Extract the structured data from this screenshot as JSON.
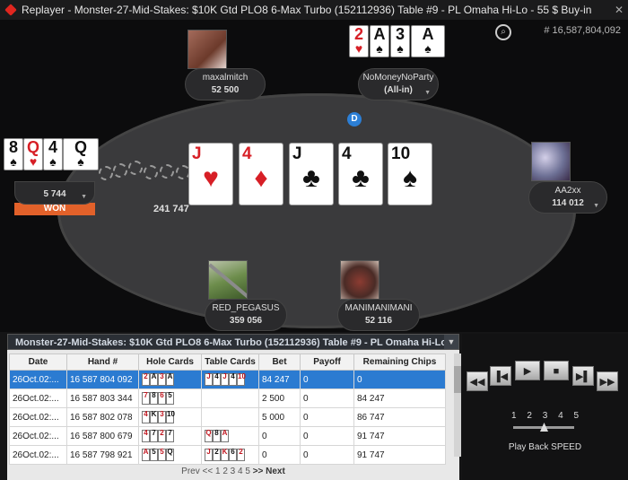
{
  "window": {
    "title": "Replayer - Monster-27-Mid-Stakes: $10K Gtd PLO8 6-Max Turbo (152112936) Table #9 -  PL  Omaha Hi-Lo - 55 $ Buy-in",
    "close": "✕"
  },
  "table": {
    "hand_number": "# 16,587,804,092",
    "pot": "241 747",
    "dealer": "D",
    "board": [
      {
        "r": "J",
        "s": "♥",
        "c": "red"
      },
      {
        "r": "4",
        "s": "♦",
        "c": "red"
      },
      {
        "r": "J",
        "s": "♣",
        "c": "blk"
      },
      {
        "r": "4",
        "s": "♣",
        "c": "blk"
      },
      {
        "r": "10",
        "s": "♠",
        "c": "blk"
      }
    ],
    "players": [
      {
        "name": "maxalmitch",
        "stack": "52 500"
      },
      {
        "name": "NoMoneyNoParty",
        "stack": "(All-in)",
        "cards": [
          {
            "r": "2",
            "s": "♥",
            "c": "red"
          },
          {
            "r": "A",
            "s": "♠",
            "c": "blk"
          },
          {
            "r": "3",
            "s": "♠",
            "c": "blk"
          },
          {
            "r": "A",
            "s": "♠",
            "c": "blk"
          }
        ]
      },
      {
        "name": "AA2xx",
        "stack": "114 012"
      },
      {
        "name": "MANIMANIMANI",
        "stack": "52 116"
      },
      {
        "name": "RED_PEGASUS",
        "stack": "359 056"
      },
      {
        "name": "",
        "stack": "5 744",
        "badge": "WON",
        "cards": [
          {
            "r": "8",
            "s": "♠",
            "c": "blk"
          },
          {
            "r": "Q",
            "s": "♥",
            "c": "red"
          },
          {
            "r": "4",
            "s": "♠",
            "c": "blk"
          },
          {
            "r": "Q",
            "s": "♠",
            "c": "blk"
          }
        ]
      }
    ]
  },
  "history": {
    "title": "Monster-27-Mid-Stakes: $10K Gtd PLO8 6-Max Turbo (152112936) Table #9 -  PL  Omaha Hi-Lo -",
    "columns": [
      "Date",
      "Hand #",
      "Hole Cards",
      "Table Cards",
      "Bet",
      "Payoff",
      "Remaining Chips"
    ],
    "rows": [
      {
        "date": "26Oct.02:...",
        "hand": "16 587 804 092",
        "hole": [
          "2",
          "A",
          "3",
          "A"
        ],
        "table": [
          "J",
          "4",
          "J",
          "4",
          "10"
        ],
        "bet": "84 247",
        "payoff": "0",
        "remaining": "0"
      },
      {
        "date": "26Oct.02:...",
        "hand": "16 587 803 344",
        "hole": [
          "7",
          "8",
          "6",
          "5"
        ],
        "table": [],
        "bet": "2 500",
        "payoff": "0",
        "remaining": "84 247"
      },
      {
        "date": "26Oct.02:...",
        "hand": "16 587 802 078",
        "hole": [
          "4",
          "K",
          "3",
          "10"
        ],
        "table": [],
        "bet": "5 000",
        "payoff": "0",
        "remaining": "86 747"
      },
      {
        "date": "26Oct.02:...",
        "hand": "16 587 800 679",
        "hole": [
          "4",
          "7",
          "2",
          "7"
        ],
        "table": [
          "Q",
          "8",
          "A"
        ],
        "bet": "0",
        "payoff": "0",
        "remaining": "91 747"
      },
      {
        "date": "26Oct.02:...",
        "hand": "16 587 798 921",
        "hole": [
          "A",
          "5",
          "5",
          "Q"
        ],
        "table": [
          "J",
          "2",
          "K",
          "6",
          "2"
        ],
        "bet": "0",
        "payoff": "0",
        "remaining": "91 747"
      }
    ],
    "pager": {
      "prev": "Prev <<",
      "pages": "1 2 3 4 5",
      "next": ">> Next"
    }
  },
  "controls": {
    "speed_ticks": [
      "1",
      "2",
      "3",
      "4",
      "5"
    ],
    "speed_label": "Play Back SPEED",
    "speed_value": 3
  }
}
